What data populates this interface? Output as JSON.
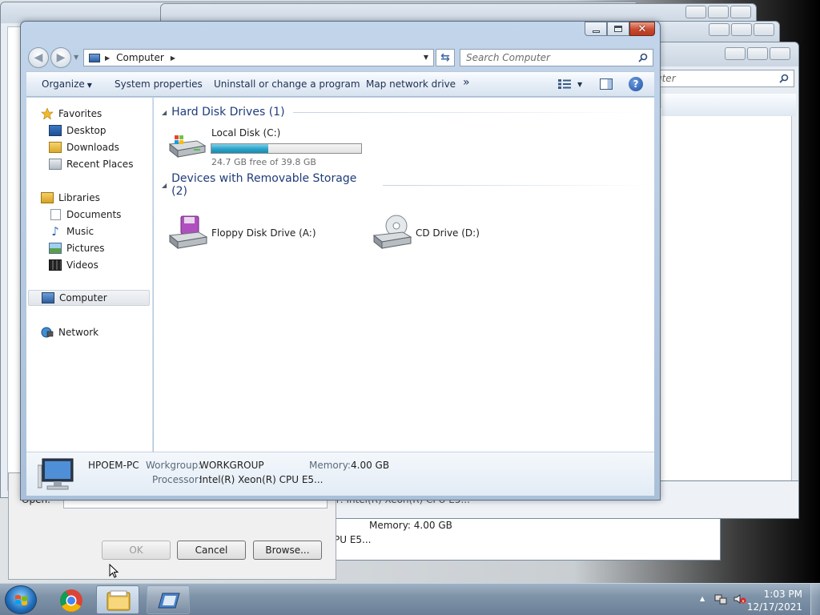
{
  "window": {
    "title": "Computer"
  },
  "address": {
    "location": "Computer"
  },
  "search": {
    "placeholder": "Search Computer"
  },
  "toolbar": {
    "organize": "Organize",
    "system_properties": "System properties",
    "uninstall": "Uninstall or change a program",
    "map_drive": "Map network drive",
    "more": "»"
  },
  "nav": {
    "favorites": "Favorites",
    "desktop": "Desktop",
    "downloads": "Downloads",
    "recent": "Recent Places",
    "libraries": "Libraries",
    "documents": "Documents",
    "music": "Music",
    "pictures": "Pictures",
    "videos": "Videos",
    "computer": "Computer",
    "network": "Network"
  },
  "groups": {
    "hard_disk": "Hard Disk Drives (1)",
    "removable": "Devices with Removable Storage (2)"
  },
  "drives": {
    "local": {
      "name": "Local Disk (C:)",
      "free": "24.7 GB free of 39.8 GB",
      "used_fraction": 0.38
    },
    "floppy": {
      "name": "Floppy Disk Drive (A:)"
    },
    "cd": {
      "name": "CD Drive (D:)"
    }
  },
  "details": {
    "pc_name": "HPOEM-PC",
    "workgroup_label": "Workgroup:",
    "workgroup": "WORKGROUP",
    "memory_label": "Memory:",
    "memory": "4.00 GB",
    "processor_label": "Processor:",
    "processor": "Intel(R) Xeon(R) CPU E5..."
  },
  "background": {
    "search_partial": "uter",
    "processor_partial": "Processor:  Intel(R) Xeon(R) CPU E5...",
    "memory_line": "Memory: 4.00 GB",
    "pu_partial": "PU E5...",
    "open_label": "Open:",
    "ok": "OK",
    "cancel": "Cancel",
    "browse": "Browse..."
  },
  "taskbar": {
    "time": "1:03 PM",
    "date": "12/17/2021"
  }
}
